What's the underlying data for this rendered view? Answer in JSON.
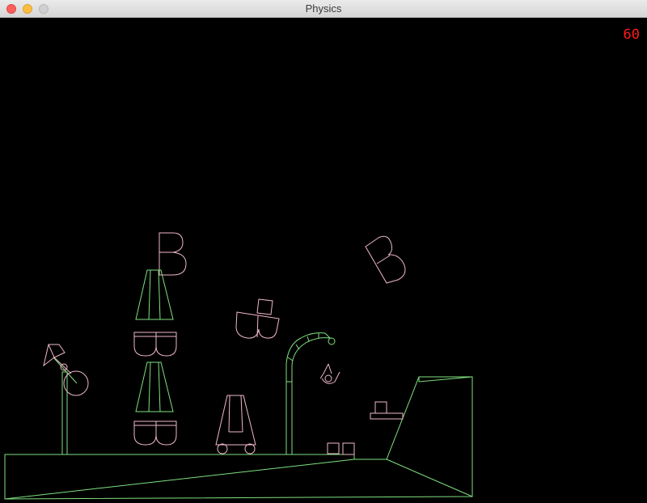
{
  "window": {
    "title": "Physics"
  },
  "hud": {
    "fps": "60"
  },
  "colors": {
    "background": "#000000",
    "static_body": "#7fe07f",
    "dynamic_body": "#f0b8c8",
    "fps_text": "#ff1a1a"
  }
}
